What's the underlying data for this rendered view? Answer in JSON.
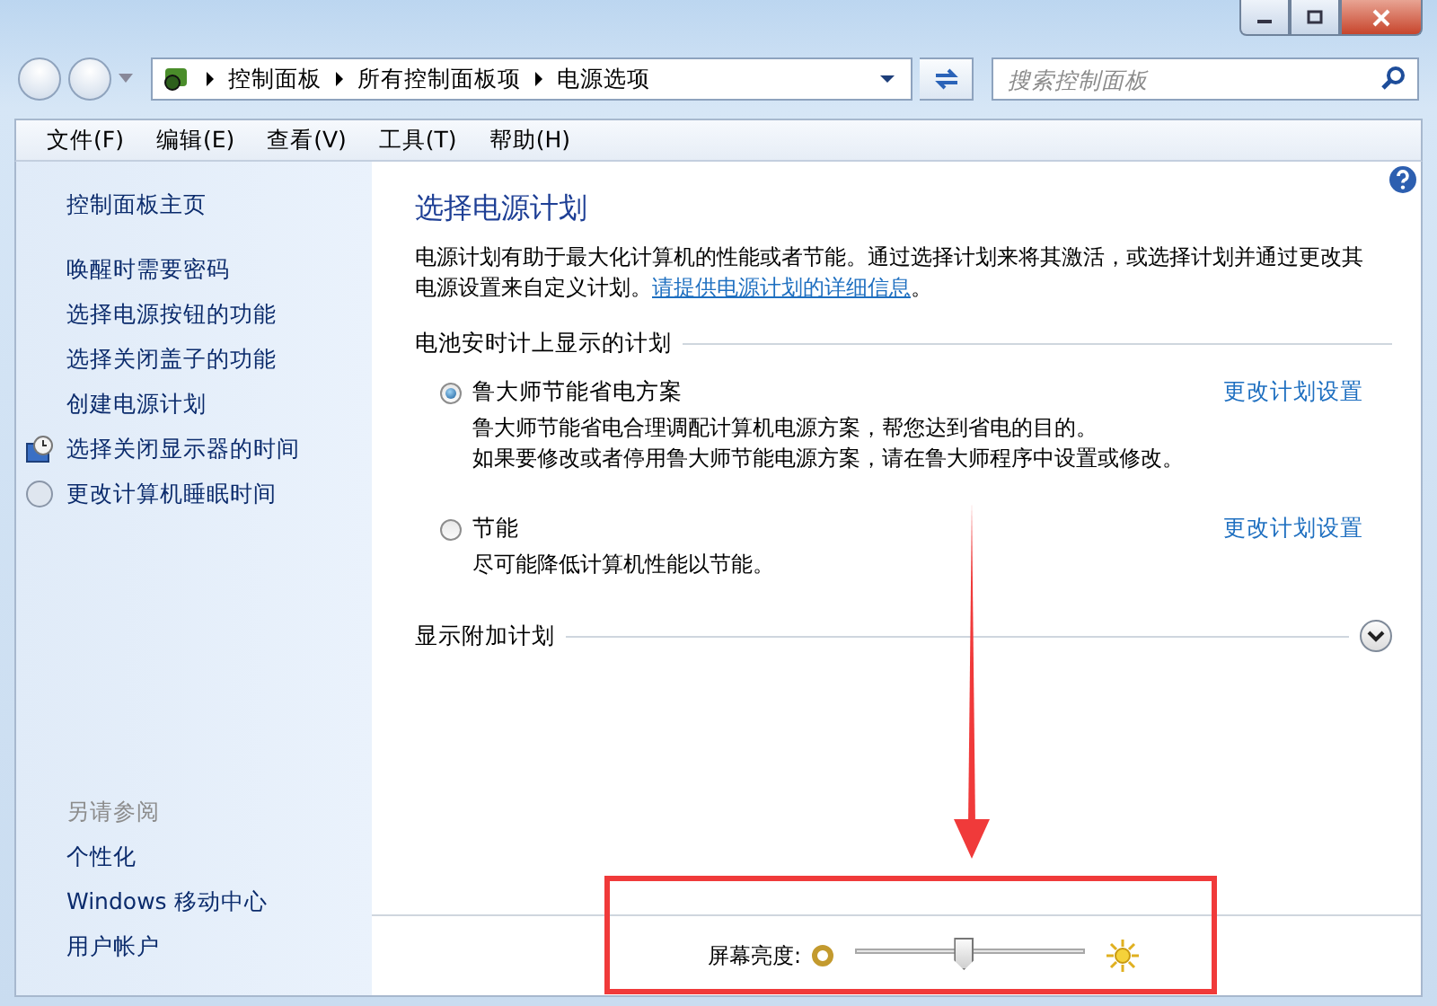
{
  "address": {
    "breadcrumbs": [
      "控制面板",
      "所有控制面板项",
      "电源选项"
    ]
  },
  "search": {
    "placeholder": "搜索控制面板"
  },
  "menu": [
    "文件(F)",
    "编辑(E)",
    "查看(V)",
    "工具(T)",
    "帮助(H)"
  ],
  "sidebar": {
    "home": "控制面板主页",
    "links": [
      {
        "label": "唤醒时需要密码",
        "kind": "plain"
      },
      {
        "label": "选择电源按钮的功能",
        "kind": "plain"
      },
      {
        "label": "选择关闭盖子的功能",
        "kind": "plain"
      },
      {
        "label": "创建电源计划",
        "kind": "plain"
      },
      {
        "label": "选择关闭显示器的时间",
        "kind": "display"
      },
      {
        "label": "更改计算机睡眠时间",
        "kind": "sleep"
      }
    ],
    "see_also": {
      "heading": "另请参阅",
      "links": [
        "个性化",
        "Windows 移动中心",
        "用户帐户"
      ]
    }
  },
  "main": {
    "title": "选择电源计划",
    "description": "电源计划有助于最大化计算机的性能或者节能。通过选择计划来将其激活，或选择计划并通过更改其电源设置来自定义计划。",
    "link": "请提供电源计划的详细信息",
    "description_end": "。",
    "section": "电池安时计上显示的计划",
    "plans": [
      {
        "name": "鲁大师节能省电方案",
        "selected": true,
        "lines": [
          "鲁大师节能省电合理调配计算机电源方案，帮您达到省电的目的。",
          "如果要修改或者停用鲁大师节能电源方案，请在鲁大师程序中设置或修改。"
        ],
        "action": "更改计划设置"
      },
      {
        "name": "节能",
        "selected": false,
        "lines": [
          "尽可能降低计算机性能以节能。"
        ],
        "action": "更改计划设置"
      }
    ],
    "more": {
      "label": "显示附加计划",
      "expanded": false
    }
  },
  "brightness": {
    "label": "屏幕亮度:",
    "level": 0.47
  }
}
